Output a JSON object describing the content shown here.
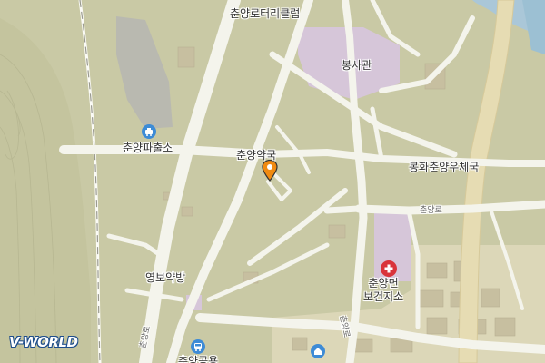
{
  "map": {
    "colors": {
      "land": "#c9c9a5",
      "road": "#f4f4ec",
      "highway": "#e6dcb3",
      "facility": "#d6c6d9"
    },
    "labels": {
      "rotary_club": "춘양로터리클럽",
      "bongsagwan": "봉사관",
      "police_box": "춘양파출소",
      "pharmacy": "춘양약국",
      "post_office": "봉화춘양우체국",
      "road_name": "춘양로",
      "yeongbo_pharmacy": "영보약방",
      "health_center_line1": "춘양면",
      "health_center_line2": "보건지소",
      "bus_stop": "춘양공용",
      "road_vertical": "춘양로",
      "road_bottom_left": "춘양로"
    },
    "icons": {
      "police": "police-icon",
      "marker": "location-pin-icon",
      "hospital": "hospital-cross-icon",
      "bus": "bus-icon",
      "building": "building-icon"
    },
    "logo": "V-WORLD"
  }
}
